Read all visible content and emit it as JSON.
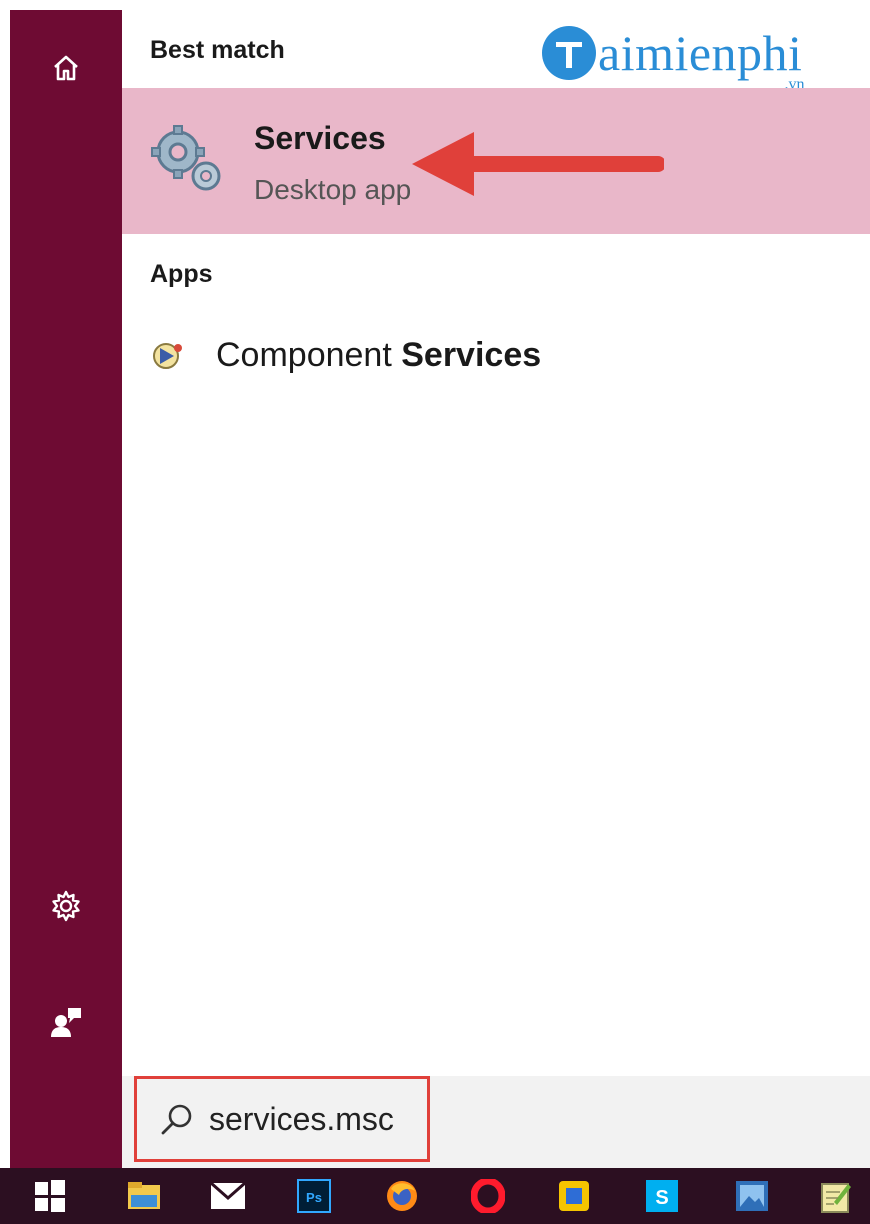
{
  "sidebar": {
    "home_icon": "home-icon",
    "settings_icon": "gear-icon",
    "feedback_icon": "feedback-icon"
  },
  "results": {
    "best_match_label": "Best match",
    "best_match": {
      "title": "Services",
      "subtitle": "Desktop app",
      "icon": "services-gear-icon"
    },
    "apps_label": "Apps",
    "apps": [
      {
        "label_prefix": "Component ",
        "label_match": "Services",
        "icon": "component-services-icon"
      }
    ]
  },
  "search": {
    "value": "services.msc",
    "icon": "search-icon"
  },
  "watermark": {
    "text": "aimienphi",
    "suffix": ".vn"
  },
  "taskbar": {
    "icons": [
      "windows-start-icon",
      "file-explorer-icon",
      "mail-icon",
      "photoshop-icon",
      "firefox-icon",
      "opera-icon",
      "app-icon",
      "skype-icon",
      "photos-icon",
      "notepad-icon"
    ],
    "photoshop_label": "Ps"
  },
  "colors": {
    "sidebar": "#6e0b33",
    "highlight": "#e9b7c9",
    "annotation_red": "#e0403a",
    "taskbar": "#2c0f21",
    "watermark_blue": "#2a8dd6"
  }
}
